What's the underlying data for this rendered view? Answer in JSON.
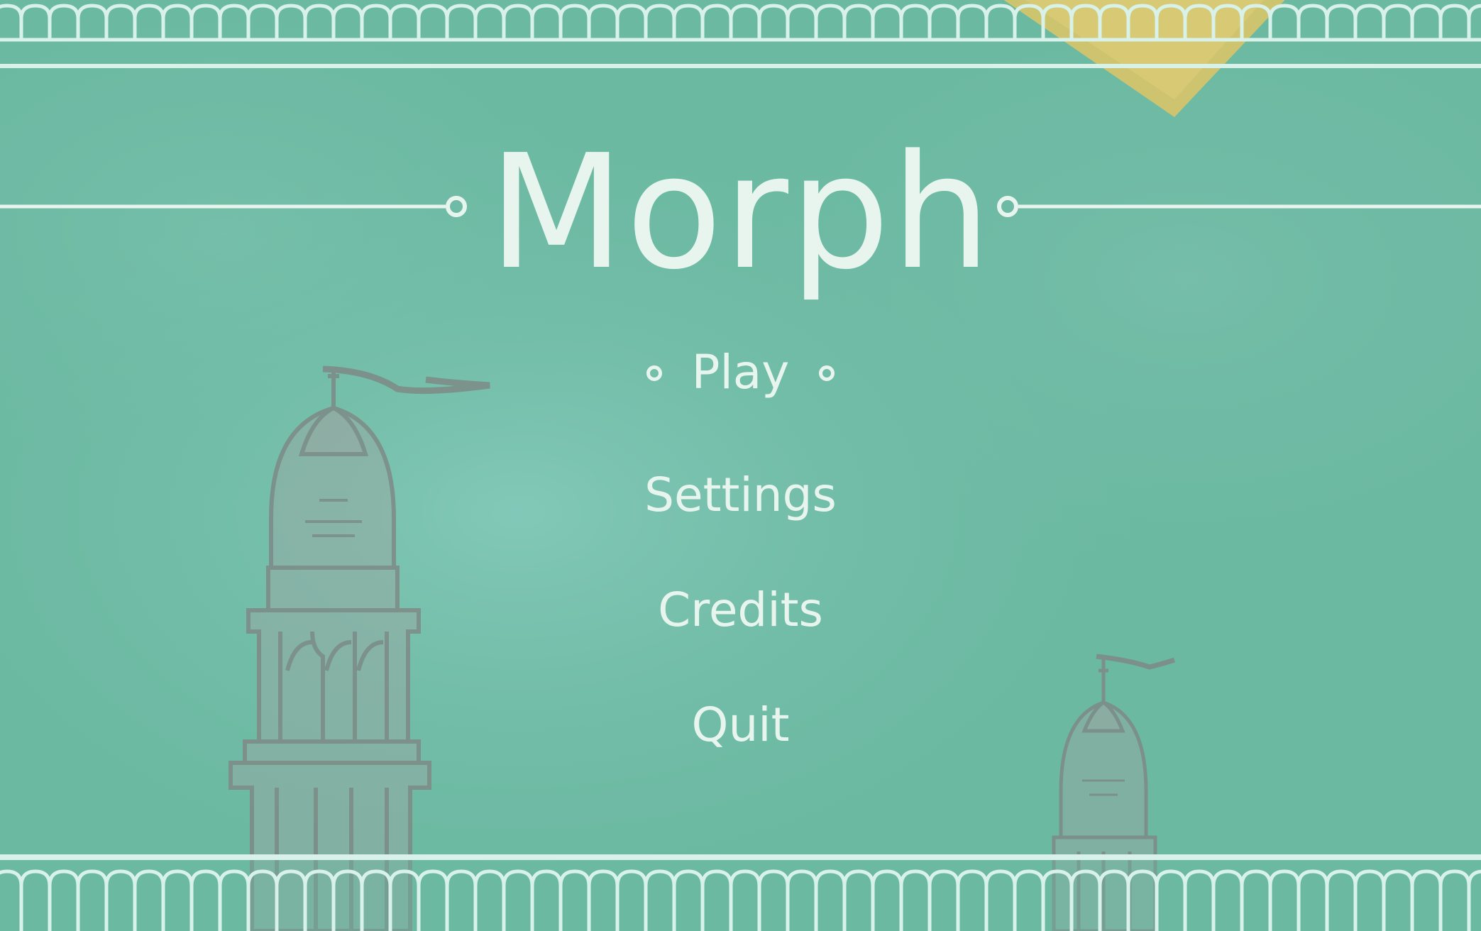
{
  "game": {
    "title": "Morph"
  },
  "menu": {
    "items": [
      {
        "label": "Play",
        "selected": true
      },
      {
        "label": "Settings",
        "selected": false
      },
      {
        "label": "Credits",
        "selected": false
      },
      {
        "label": "Quit",
        "selected": false
      }
    ]
  },
  "colors": {
    "background": "#6cb9a2",
    "text": "#e8f5ef",
    "border": "#d8f1e9",
    "tower": "#8f9e99",
    "accent": "#e0c772"
  }
}
